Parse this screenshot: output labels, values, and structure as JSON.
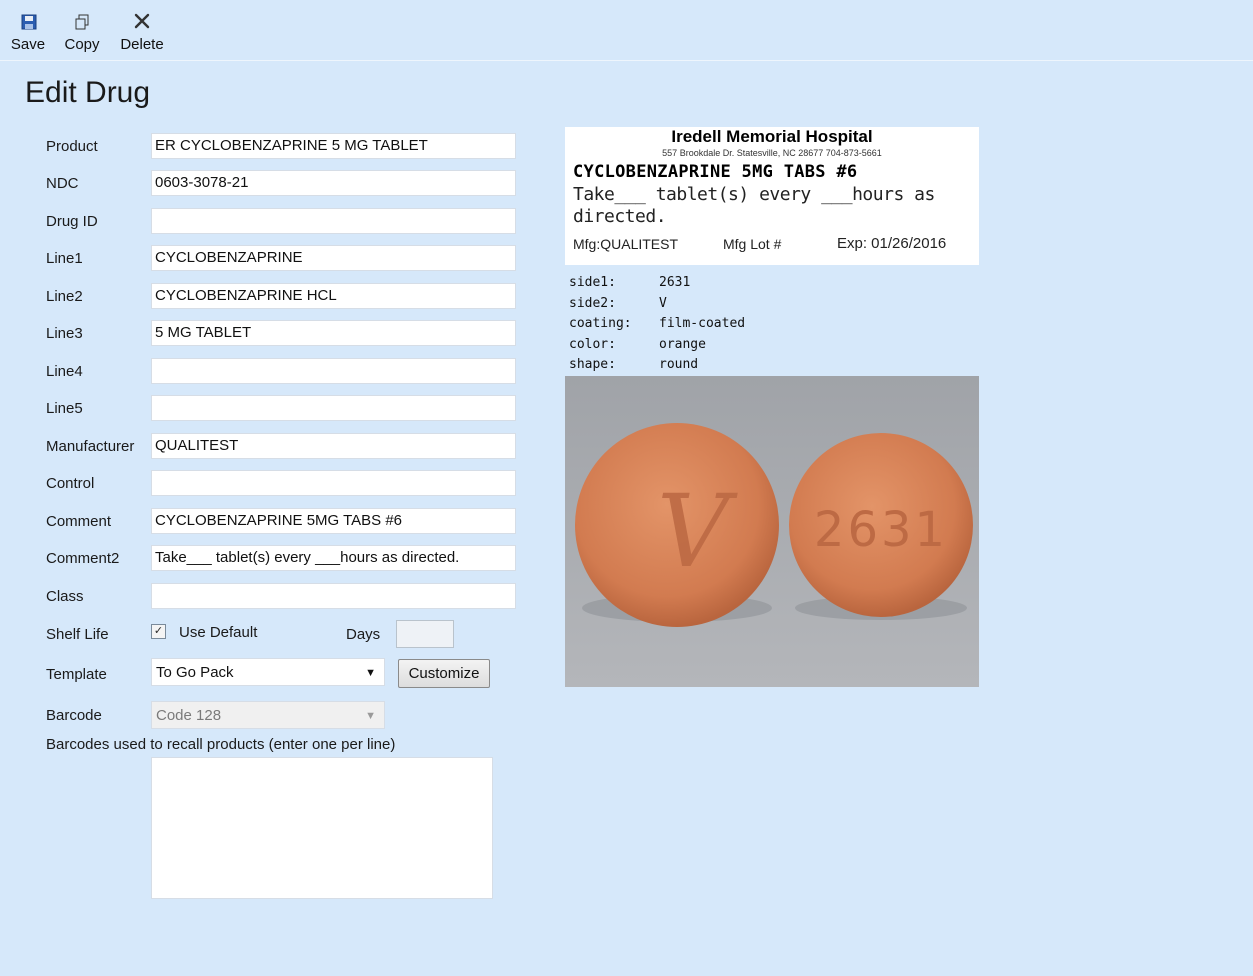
{
  "toolbar": {
    "save_label": "Save",
    "copy_label": "Copy",
    "delete_label": "Delete",
    "save_icon": "floppy-disk-icon",
    "copy_icon": "copy-icon",
    "delete_icon": "x-icon"
  },
  "page": {
    "title": "Edit Drug"
  },
  "form": {
    "labels": {
      "product": "Product",
      "ndc": "NDC",
      "drug_id": "Drug ID",
      "line1": "Line1",
      "line2": "Line2",
      "line3": "Line3",
      "line4": "Line4",
      "line5": "Line5",
      "manufacturer": "Manufacturer",
      "control": "Control",
      "comment": "Comment",
      "comment2": "Comment2",
      "class": "Class",
      "shelf_life": "Shelf Life",
      "template": "Template",
      "barcode": "Barcode"
    },
    "values": {
      "product": "ER CYCLOBENZAPRINE 5 MG TABLET",
      "ndc": "0603-3078-21",
      "drug_id": "",
      "line1": "CYCLOBENZAPRINE",
      "line2": "CYCLOBENZAPRINE HCL",
      "line3": "5 MG TABLET",
      "line4": "",
      "line5": "",
      "manufacturer": "QUALITEST",
      "control": "",
      "comment": "CYCLOBENZAPRINE 5MG TABS #6",
      "comment2": "Take___ tablet(s) every ___hours as directed.",
      "class": ""
    },
    "shelf_life": {
      "use_default_label": "Use Default",
      "use_default_checked": "✓",
      "days_label": "Days",
      "days_value": ""
    },
    "template": {
      "selected": "To Go Pack",
      "customize_label": "Customize"
    },
    "barcode": {
      "selected": "Code 128"
    },
    "barcodes_recall_label": "Barcodes used to recall products (enter one per line)",
    "barcodes_recall_value": ""
  },
  "label_preview": {
    "hospital": "Iredell Memorial Hospital",
    "address": "557 Brookdale Dr. Statesville, NC 28677 704-873-5661",
    "drug_line": "CYCLOBENZAPRINE 5MG TABS #6",
    "instructions": "Take___ tablet(s) every ___hours as directed.",
    "mfg": "Mfg:QUALITEST",
    "lot": "Mfg Lot #",
    "exp": "Exp: 01/26/2016"
  },
  "imprint": {
    "side1_key": "side1:",
    "side1": "2631",
    "side2_key": "side2:",
    "side2": "V",
    "coating_key": "coating:",
    "coating": "film-coated",
    "color_key": "color:",
    "color": "orange",
    "shape_key": "shape:",
    "shape": "round"
  },
  "pill_photo": {
    "left_imprint": "V",
    "right_imprint": "2631",
    "pill_color": "#d9835a",
    "background_color": "#a3a6ab"
  }
}
